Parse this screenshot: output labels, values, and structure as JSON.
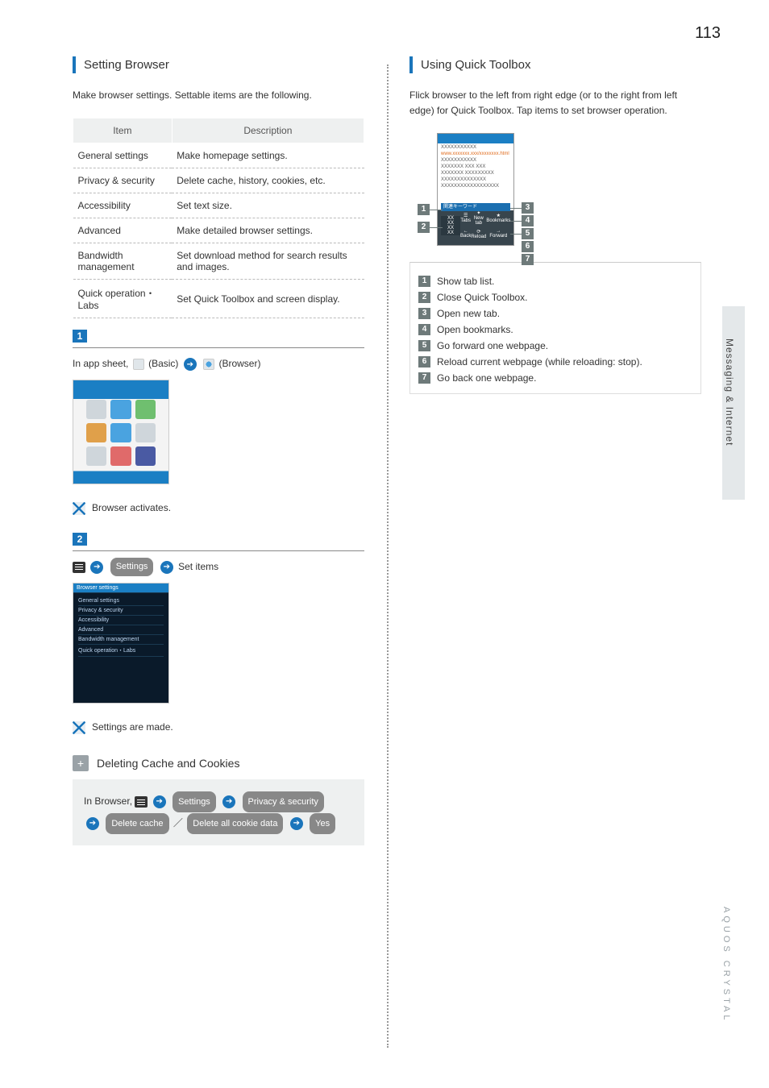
{
  "page_number": "113",
  "side_tab": "Messaging & Internet",
  "footer_brand": "AQUOS CRYSTAL",
  "left": {
    "heading": "Setting Browser",
    "intro": "Make browser settings. Settable items are the following.",
    "table": {
      "head_item": "Item",
      "head_desc": "Description",
      "rows": [
        {
          "item": "General settings",
          "desc": "Make homepage settings."
        },
        {
          "item": "Privacy & security",
          "desc": "Delete cache, history, cookies, etc."
        },
        {
          "item": "Accessibility",
          "desc": "Set text size."
        },
        {
          "item": "Advanced",
          "desc": "Make detailed browser settings."
        },
        {
          "item": "Bandwidth management",
          "desc": "Set download method for search results and images."
        },
        {
          "item": "Quick operation・Labs",
          "desc": "Set Quick Toolbox and screen display."
        }
      ]
    },
    "step1": {
      "num": "1",
      "pre": "In app sheet,",
      "basic": "(Basic)",
      "browser": "(Browser)",
      "note": "Browser activates."
    },
    "step2": {
      "num": "2",
      "settings": "Settings",
      "setitems": "Set items",
      "settings_list": [
        "General settings",
        "Privacy & security",
        "Accessibility",
        "Advanced",
        "Bandwidth management",
        "Quick operation・Labs"
      ],
      "settings_header": "Browser settings",
      "note": "Settings are made."
    },
    "sub": {
      "title": "Deleting Cache and Cookies",
      "pre": "In Browser,",
      "settings": "Settings",
      "privacy": "Privacy & security",
      "delcache": "Delete cache",
      "slash": "／",
      "delcookie": "Delete all cookie data",
      "yes": "Yes"
    }
  },
  "right": {
    "heading": "Using Quick Toolbox",
    "intro": "Flick browser to the left from right edge (or to the right from left edge) for Quick Toolbox. Tap items to set browser operation.",
    "legend": [
      "Show tab list.",
      "Close Quick Toolbox.",
      "Open new tab.",
      "Open bookmarks.",
      "Go forward one webpage.",
      "Reload current webpage (while reloading: stop).",
      "Go back one webpage."
    ]
  }
}
